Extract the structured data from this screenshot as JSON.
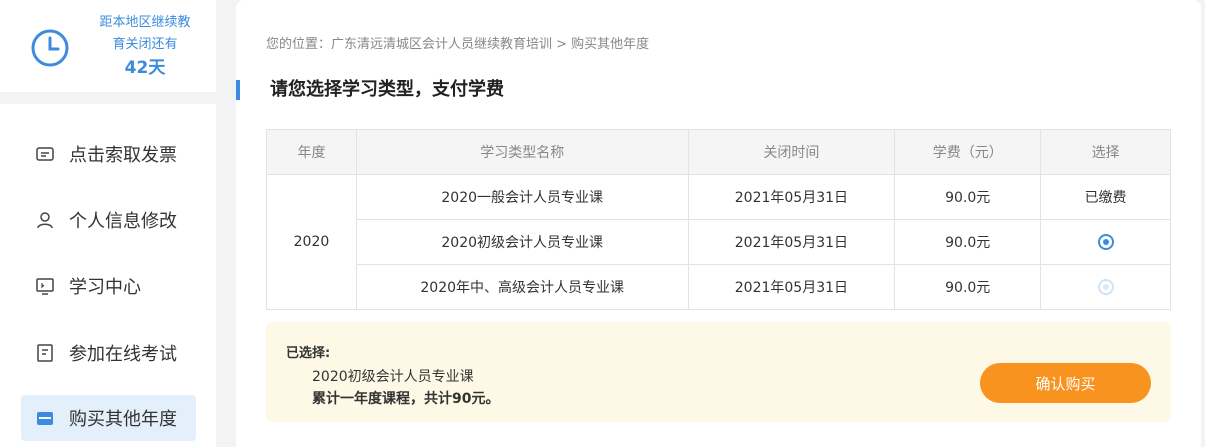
{
  "sidebar": {
    "countdown": {
      "line1": "距本地区继续教",
      "line2": "育关闭还有",
      "days": "42天"
    },
    "items": [
      {
        "label": "点击索取发票",
        "icon": "invoice-icon"
      },
      {
        "label": "个人信息修改",
        "icon": "user-icon"
      },
      {
        "label": "学习中心",
        "icon": "monitor-icon"
      },
      {
        "label": "参加在线考试",
        "icon": "exam-icon"
      },
      {
        "label": "购买其他年度",
        "icon": "purchase-icon",
        "active": true
      }
    ]
  },
  "breadcrumb": "您的位置：广东清远清城区会计人员继续教育培训 > 购买其他年度",
  "section_title": "请您选择学习类型，支付学费",
  "table": {
    "headers": [
      "年度",
      "学习类型名称",
      "关闭时间",
      "学费（元）",
      "选择"
    ],
    "year": "2020",
    "rows": [
      {
        "name": "2020一般会计人员专业课",
        "close": "2021年05月31日",
        "fee": "90.0元",
        "select": "已缴费"
      },
      {
        "name": "2020初级会计人员专业课",
        "close": "2021年05月31日",
        "fee": "90.0元",
        "select": "checked"
      },
      {
        "name": "2020年中、高级会计人员专业课",
        "close": "2021年05月31日",
        "fee": "90.0元",
        "select": "disabled"
      }
    ]
  },
  "summary": {
    "label": "已选择:",
    "course": "2020初级会计人员专业课",
    "total": "累计一年度课程，共计90元。"
  },
  "confirm_label": "确认购买",
  "colors": {
    "accent": "#3b8cde",
    "button": "#f7931e",
    "summary_bg": "#fef9e7"
  }
}
